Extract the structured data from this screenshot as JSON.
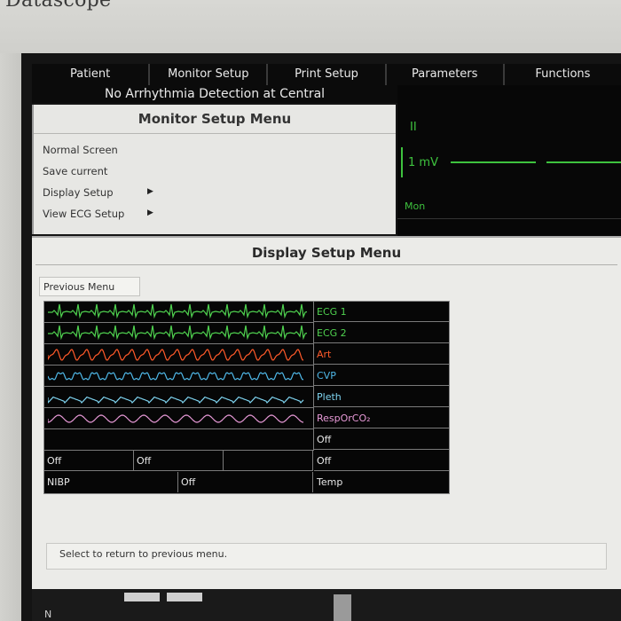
{
  "brand": "Datascope",
  "menu": [
    "Patient",
    "Monitor Setup",
    "Print Setup",
    "Parameters",
    "Functions"
  ],
  "alarm_banner": "No Arrhythmia Detection at Central",
  "monitor_setup": {
    "title": "Monitor Setup Menu",
    "items": [
      "Normal Screen",
      "Save current",
      "Display Setup",
      "View ECG Setup"
    ]
  },
  "ecg": {
    "lead": "II",
    "scale": "1 mV",
    "mode": "Mon"
  },
  "display_setup": {
    "title": "Display Setup Menu",
    "previous_button": "Previous Menu",
    "rows": [
      {
        "label": "ECG 1",
        "color": "#4fd14f",
        "wave": "ecg"
      },
      {
        "label": "ECG 2",
        "color": "#4fd14f",
        "wave": "ecg"
      },
      {
        "label": "Art",
        "color": "#ff5a2a",
        "wave": "art"
      },
      {
        "label": "CVP",
        "color": "#4fb8e8",
        "wave": "cvp"
      },
      {
        "label": "Pleth",
        "color": "#7fd4f0",
        "wave": "pleth"
      },
      {
        "label": "RespOrCO₂",
        "color": "#e89ad8",
        "wave": "resp"
      }
    ],
    "row7_label": "Off",
    "row8": {
      "a": "Off",
      "b": "Off",
      "label": "Off"
    },
    "row9": {
      "a": "NIBP",
      "b": "Off",
      "label": "Temp"
    },
    "hint": "Select to return to previous menu."
  },
  "bottom_label": "N"
}
